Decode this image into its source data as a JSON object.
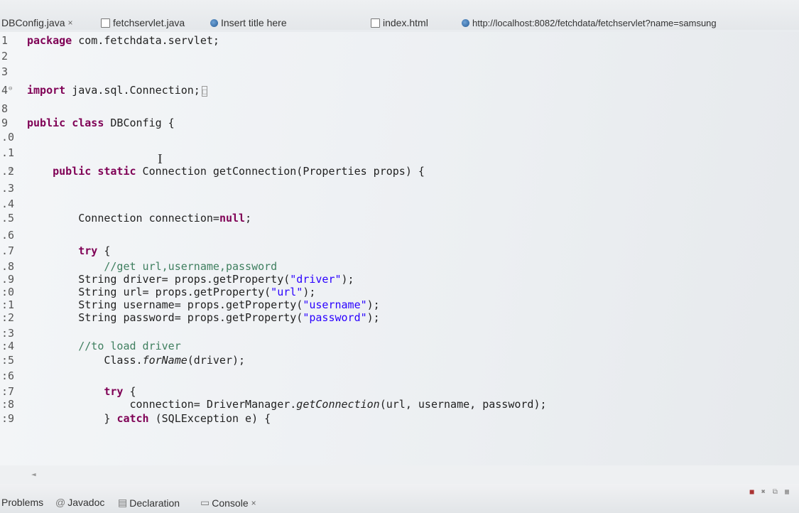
{
  "editor_tabs": [
    {
      "label": "DBConfig.java",
      "close": "×",
      "icon": "java-file-icon"
    },
    {
      "label": "fetchservlet.java",
      "icon": "java-file-icon"
    },
    {
      "label": "Insert title here",
      "icon": "globe-icon"
    },
    {
      "label": "index.html",
      "icon": "html-file-icon"
    },
    {
      "label": "http://localhost:8082/fetchdata/fetchservlet?name=samsung",
      "icon": "globe-icon"
    }
  ],
  "code_lines": [
    {
      "n": "1",
      "code": "package com.fetchdata.servlet;"
    },
    {
      "n": "2",
      "code": ""
    },
    {
      "n": "3",
      "code": ""
    },
    {
      "n": "4",
      "code": "import java.sql.Connection;"
    },
    {
      "n": "8",
      "code": ""
    },
    {
      "n": "9",
      "code": "public class DBConfig {"
    },
    {
      "n": ".0",
      "code": ""
    },
    {
      "n": ".1",
      "code": ""
    },
    {
      "n": ".2",
      "code": "    public static Connection getConnection(Properties props) {"
    },
    {
      "n": ".3",
      "code": ""
    },
    {
      "n": ".4",
      "code": ""
    },
    {
      "n": ".5",
      "code": "        Connection connection=null;"
    },
    {
      "n": ".6",
      "code": ""
    },
    {
      "n": ".7",
      "code": "        try {"
    },
    {
      "n": ".8",
      "code": "            //get url,username,password"
    },
    {
      "n": ".9",
      "code": "        String driver= props.getProperty(\"driver\");"
    },
    {
      "n": ":0",
      "code": "        String url= props.getProperty(\"url\");"
    },
    {
      "n": ":1",
      "code": "        String username= props.getProperty(\"username\");"
    },
    {
      "n": ":2",
      "code": "        String password= props.getProperty(\"password\");"
    },
    {
      "n": ":3",
      "code": ""
    },
    {
      "n": ":4",
      "code": "        //to load driver"
    },
    {
      "n": ":5",
      "code": "            Class.forName(driver);"
    },
    {
      "n": ":6",
      "code": ""
    },
    {
      "n": ":7",
      "code": "            try {"
    },
    {
      "n": ":8",
      "code": "                connection= DriverManager.getConnection(url, username, password);"
    },
    {
      "n": ":9",
      "code": "            } catch (SQLException e) {"
    }
  ],
  "bottom_tabs": [
    {
      "label": "Problems"
    },
    {
      "label": "Javadoc"
    },
    {
      "label": "Declaration"
    },
    {
      "label": "Console",
      "close": "×"
    }
  ],
  "scroll_arrow": "◄",
  "folded_marker": "□"
}
